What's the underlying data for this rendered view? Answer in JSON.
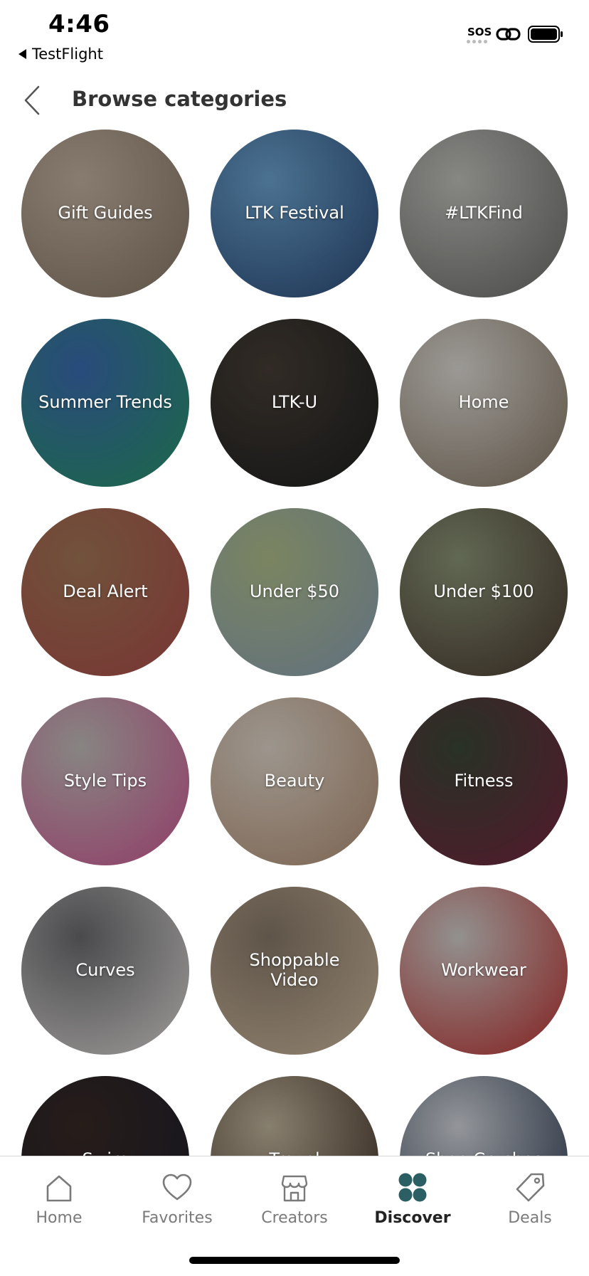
{
  "status_bar": {
    "time": "4:46",
    "back_app": "TestFlight",
    "sos": "SOS"
  },
  "header": {
    "title": "Browse categories"
  },
  "categories": [
    {
      "label": "Gift Guides",
      "colors": [
        "#c9b7a6",
        "#8b7a69"
      ]
    },
    {
      "label": "LTK Festival",
      "colors": [
        "#6fa9d6",
        "#2c4b7a"
      ]
    },
    {
      "label": "#LTKFind",
      "colors": [
        "#c7c7c2",
        "#6d6f6b"
      ]
    },
    {
      "label": "Summer Trends",
      "colors": [
        "#3d6fb8",
        "#2a9a6a"
      ]
    },
    {
      "label": "LTK-U",
      "colors": [
        "#4a4038",
        "#1d2020"
      ]
    },
    {
      "label": "Home",
      "colors": [
        "#e5e2dc",
        "#8a7a66"
      ]
    },
    {
      "label": "Deal Alert",
      "colors": [
        "#a77a58",
        "#b24f4c"
      ]
    },
    {
      "label": "Under $50",
      "colors": [
        "#b5c48f",
        "#8fa6bd"
      ]
    },
    {
      "label": "Under $100",
      "colors": [
        "#8f9a7b",
        "#4b3a30"
      ]
    },
    {
      "label": "Style Tips",
      "colors": [
        "#c8c4c0",
        "#d65a9a"
      ]
    },
    {
      "label": "Beauty",
      "colors": [
        "#e7ddd0",
        "#b89478"
      ]
    },
    {
      "label": "Fitness",
      "colors": [
        "#3c4a38",
        "#7a2642"
      ]
    },
    {
      "label": "Curves",
      "colors": [
        "#6e6e72",
        "#e9e6e2"
      ]
    },
    {
      "label": "Shoppable Video",
      "colors": [
        "#8c7d6c",
        "#d8c2a6"
      ]
    },
    {
      "label": "Workwear",
      "colors": [
        "#d8d6d3",
        "#c2302e"
      ]
    },
    {
      "label": "Swim",
      "colors": [
        "#3a2b26",
        "#1d1f2f"
      ]
    },
    {
      "label": "Travel",
      "colors": [
        "#c8bca3",
        "#3b2a1f"
      ]
    },
    {
      "label": "Shoe Crushes",
      "colors": [
        "#d9dce2",
        "#26374f"
      ]
    }
  ],
  "nav": {
    "items": [
      {
        "label": "Home",
        "icon": "home-icon"
      },
      {
        "label": "Favorites",
        "icon": "heart-icon"
      },
      {
        "label": "Creators",
        "icon": "storefront-icon"
      },
      {
        "label": "Discover",
        "icon": "discover-grid-icon"
      },
      {
        "label": "Deals",
        "icon": "tag-icon"
      }
    ],
    "active_index": 3,
    "active_color": "#2b5f63",
    "inactive_color": "#7a7a7a"
  }
}
